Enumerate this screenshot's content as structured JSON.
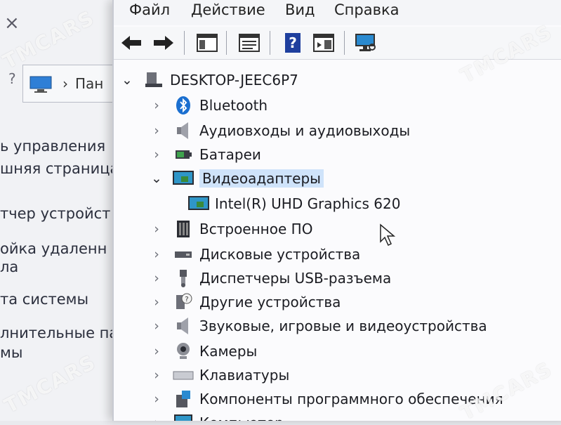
{
  "background_panel": {
    "breadcrumb_text": "Пан",
    "links": [
      "ь управления",
      "шняя страница",
      "тчер устройст",
      "ойка удаленн",
      "ла",
      "та системы",
      "лнительные па",
      "мы"
    ]
  },
  "menu": {
    "items": [
      "Файл",
      "Действие",
      "Вид",
      "Справка"
    ]
  },
  "toolbar": {
    "buttons": [
      "back-arrow-icon",
      "forward-arrow-icon",
      "console-tree-icon",
      "properties-icon",
      "help-icon",
      "action-pane-icon",
      "scan-hardware-icon"
    ]
  },
  "tree": {
    "root": "DESKTOP-JEEC6P7",
    "items": [
      {
        "label": "Bluetooth",
        "icon": "bluetooth-icon",
        "expanded": false
      },
      {
        "label": "Аудиовходы и аудиовыходы",
        "icon": "speaker-icon",
        "expanded": false
      },
      {
        "label": "Батареи",
        "icon": "battery-icon",
        "expanded": false
      },
      {
        "label": "Видеоадаптеры",
        "icon": "display-adapter-icon",
        "expanded": true,
        "selected": true
      },
      {
        "label": "Intel(R) UHD Graphics 620",
        "icon": "display-adapter-icon",
        "child": true
      },
      {
        "label": "Встроенное ПО",
        "icon": "firmware-icon",
        "expanded": false
      },
      {
        "label": "Дисковые устройства",
        "icon": "disk-drive-icon",
        "expanded": false
      },
      {
        "label": "Диспетчеры USB-разъема",
        "icon": "usb-icon",
        "expanded": false
      },
      {
        "label": "Другие устройства",
        "icon": "unknown-device-icon",
        "expanded": false
      },
      {
        "label": "Звуковые, игровые и видеоустройства",
        "icon": "sound-device-icon",
        "expanded": false
      },
      {
        "label": "Камеры",
        "icon": "camera-icon",
        "expanded": false
      },
      {
        "label": "Клавиатуры",
        "icon": "keyboard-icon",
        "expanded": false
      },
      {
        "label": "Компоненты программного обеспечения",
        "icon": "software-component-icon",
        "expanded": false
      },
      {
        "label": "Компьютер",
        "icon": "computer-icon",
        "expanded": false
      }
    ]
  },
  "watermark": "TMCARS"
}
